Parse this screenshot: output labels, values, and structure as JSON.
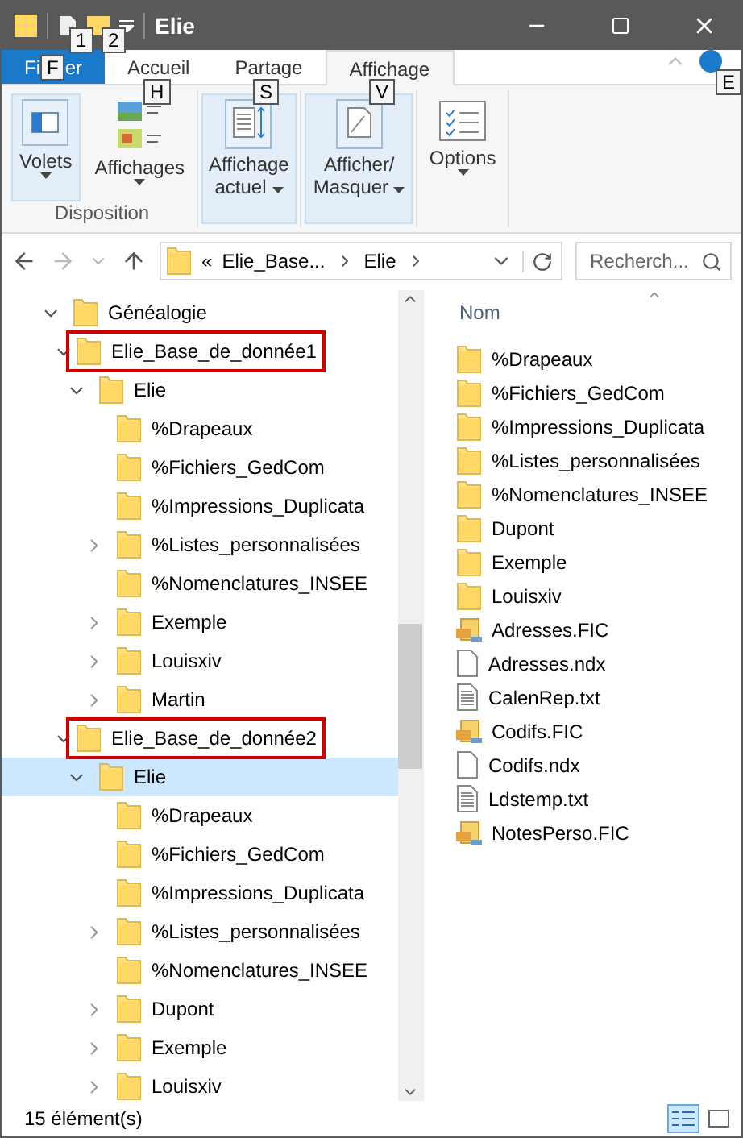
{
  "window": {
    "title": "Elie",
    "quick_access_keytips": [
      "1",
      "2"
    ]
  },
  "ribbon_tabs": [
    {
      "kind": "file",
      "label_start": "Fi",
      "label_end": "er",
      "keytip": "F",
      "selected": false
    },
    {
      "kind": "tab",
      "label": "Accueil",
      "keytip": "H",
      "selected": false
    },
    {
      "kind": "tab",
      "label": "Partage",
      "keytip": "S",
      "selected": false
    },
    {
      "kind": "tab",
      "label": "Affichage",
      "keytip": "V",
      "selected": true
    }
  ],
  "help_keytip": "E",
  "ribbon_groups": [
    {
      "label": "Disposition",
      "framed": true,
      "buttons": [
        {
          "kind": "panes",
          "lines": [
            "Volets"
          ]
        },
        {
          "kind": "layouts",
          "lines": [
            "Affichages"
          ]
        }
      ]
    },
    {
      "framed": true,
      "buttons": [
        {
          "kind": "current",
          "lines": [
            "Affichage",
            "actuel"
          ]
        }
      ]
    },
    {
      "framed": true,
      "buttons": [
        {
          "kind": "showhide",
          "lines": [
            "Afficher/",
            "Masquer"
          ]
        }
      ]
    },
    {
      "framed": false,
      "buttons": [
        {
          "kind": "options",
          "lines": [
            "Options"
          ]
        }
      ]
    }
  ],
  "address": {
    "overflow": "«",
    "crumbs": [
      "Elie_Base...",
      "Elie"
    ]
  },
  "search": {
    "placeholder": "Recherch..."
  },
  "tree": [
    {
      "label": "Généalogie",
      "expanded": true,
      "selected": false,
      "marked": false,
      "children": [
        {
          "label": "Elie_Base_de_donnée1",
          "expanded": true,
          "selected": false,
          "marked": true,
          "children": [
            {
              "label": "Elie",
              "expanded": true,
              "selected": false,
              "marked": false,
              "children": [
                {
                  "label": "%Drapeaux",
                  "selected": false,
                  "marked": false
                },
                {
                  "label": "%Fichiers_GedCom",
                  "selected": false,
                  "marked": false
                },
                {
                  "label": "%Impressions_Duplicata",
                  "selected": false,
                  "marked": false
                },
                {
                  "label": "%Listes_personnalisées",
                  "expanded": false,
                  "selected": false,
                  "marked": false
                },
                {
                  "label": "%Nomenclatures_INSEE",
                  "selected": false,
                  "marked": false
                },
                {
                  "label": "Exemple",
                  "expanded": false,
                  "selected": false,
                  "marked": false
                },
                {
                  "label": "Louisxiv",
                  "expanded": false,
                  "selected": false,
                  "marked": false
                },
                {
                  "label": "Martin",
                  "expanded": false,
                  "selected": false,
                  "marked": false
                }
              ]
            }
          ]
        },
        {
          "label": "Elie_Base_de_donnée2",
          "expanded": true,
          "selected": false,
          "marked": true,
          "children": [
            {
              "label": "Elie",
              "expanded": true,
              "selected": true,
              "marked": false,
              "children": [
                {
                  "label": "%Drapeaux",
                  "selected": false,
                  "marked": false
                },
                {
                  "label": "%Fichiers_GedCom",
                  "selected": false,
                  "marked": false
                },
                {
                  "label": "%Impressions_Duplicata",
                  "selected": false,
                  "marked": false
                },
                {
                  "label": "%Listes_personnalisées",
                  "expanded": false,
                  "selected": false,
                  "marked": false
                },
                {
                  "label": "%Nomenclatures_INSEE",
                  "selected": false,
                  "marked": false
                },
                {
                  "label": "Dupont",
                  "expanded": false,
                  "selected": false,
                  "marked": false
                },
                {
                  "label": "Exemple",
                  "expanded": false,
                  "selected": false,
                  "marked": false
                },
                {
                  "label": "Louisxiv",
                  "expanded": false,
                  "selected": false,
                  "marked": false
                }
              ]
            }
          ]
        }
      ]
    }
  ],
  "files": {
    "column": "Nom",
    "items": [
      {
        "name": "%Drapeaux",
        "kind": "folder"
      },
      {
        "name": "%Fichiers_GedCom",
        "kind": "folder"
      },
      {
        "name": "%Impressions_Duplicata",
        "kind": "folder"
      },
      {
        "name": "%Listes_personnalisées",
        "kind": "folder"
      },
      {
        "name": "%Nomenclatures_INSEE",
        "kind": "folder"
      },
      {
        "name": "Dupont",
        "kind": "folder"
      },
      {
        "name": "Exemple",
        "kind": "folder"
      },
      {
        "name": "Louisxiv",
        "kind": "folder"
      },
      {
        "name": "Adresses.FIC",
        "kind": "database"
      },
      {
        "name": "Adresses.ndx",
        "kind": "blank"
      },
      {
        "name": "CalenRep.txt",
        "kind": "text"
      },
      {
        "name": "Codifs.FIC",
        "kind": "database"
      },
      {
        "name": "Codifs.ndx",
        "kind": "blank"
      },
      {
        "name": "Ldstemp.txt",
        "kind": "text"
      },
      {
        "name": "NotesPerso.FIC",
        "kind": "database"
      }
    ]
  },
  "status_bar": {
    "count": "15 élément(s)"
  }
}
